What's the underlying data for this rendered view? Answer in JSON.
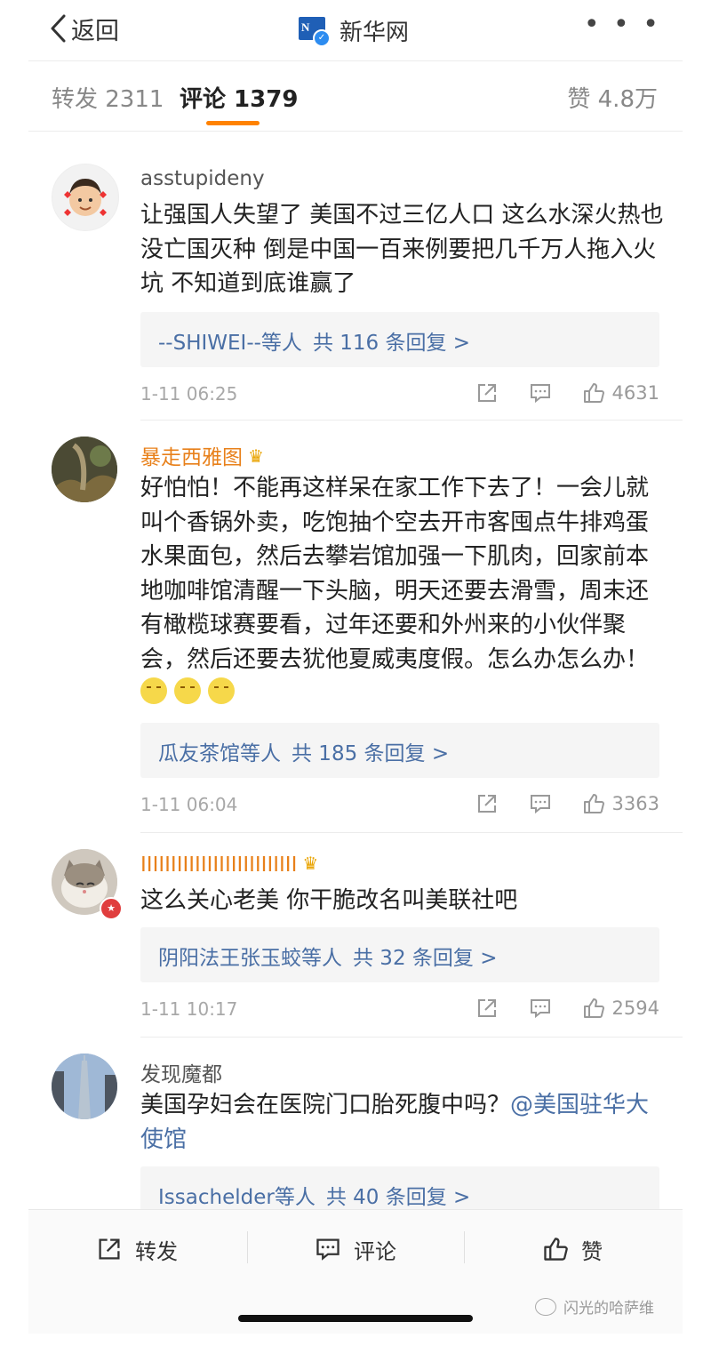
{
  "topbar": {
    "back_label": "返回",
    "title": "新华网",
    "logo_text": "N",
    "more_label": "• • •"
  },
  "tabs": {
    "repost": "转发 2311",
    "comment": "评论 1379",
    "like": "赞 4.8万"
  },
  "comments": [
    {
      "username": "asstupideny",
      "text": "让强国人失望了 美国不过三亿人口 这么水深火热也没亡国灭种 倒是中国一百来例要把几千万人拖入火坑 不知道到底谁赢了",
      "reply_who": "--SHIWEI--等人",
      "reply_count": "共 116 条回复 >",
      "time": "1-11 06:25",
      "likes": "4631"
    },
    {
      "username": "暴走西雅图",
      "text": "好怕怕！不能再这样呆在家工作下去了！一会儿就叫个香锅外卖，吃饱抽个空去开市客囤点牛排鸡蛋水果面包，然后去攀岩馆加强一下肌肉，回家前本地咖啡馆清醒一下头脑，明天还要去滑雪，周末还有橄榄球赛要看，过年还要和外州来的小伙伴聚会，然后还要去犹他夏威夷度假。怎么办怎么办！",
      "reply_who": "瓜友茶馆等人",
      "reply_count": "共 185 条回复 >",
      "time": "1-11 06:04",
      "likes": "3363"
    },
    {
      "username": "IIIIIIIIIIIIIIIIIIIIIIIIII",
      "text": "这么关心老美 你干脆改名叫美联社吧",
      "reply_who": "阴阳法王张玉蛟等人",
      "reply_count": "共 32 条回复 >",
      "time": "1-11 10:17",
      "likes": "2594"
    },
    {
      "username": "发现魔都",
      "text": "美国孕妇会在医院门口胎死腹中吗？",
      "mention": "@美国驻华大使馆",
      "reply_who": "Issachelder等人",
      "reply_count": "共 40 条回复 >"
    }
  ],
  "bottombar": {
    "repost": "转发",
    "comment": "评论",
    "like": "赞"
  },
  "watermark": "闪光的哈萨维",
  "colors": {
    "accent": "#ff8200",
    "link": "#4a6fa5",
    "username_vip": "#e8801a"
  }
}
